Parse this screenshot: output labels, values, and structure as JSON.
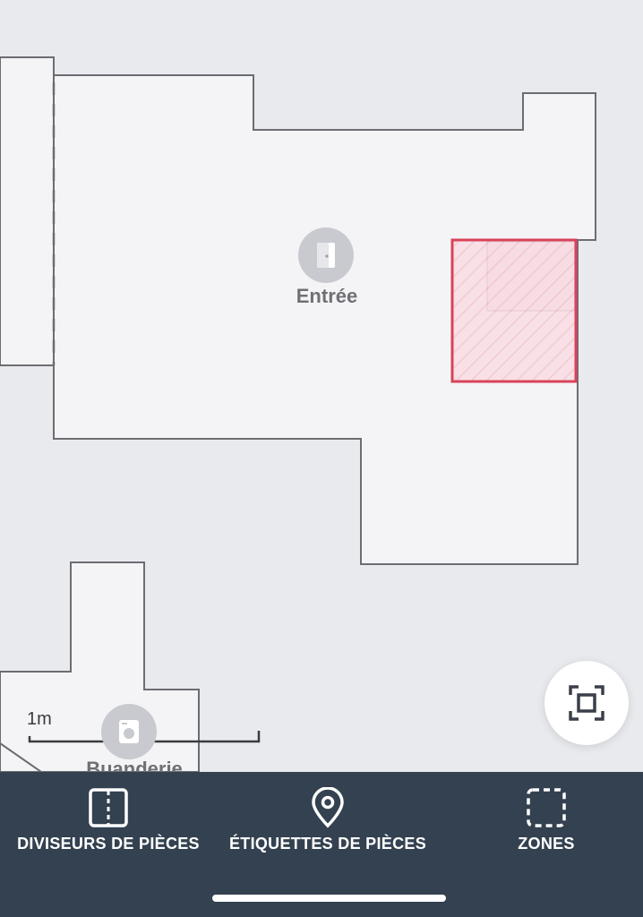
{
  "map": {
    "rooms": [
      {
        "name": "Entrée",
        "icon": "door-icon"
      },
      {
        "name": "Buanderie",
        "icon": "washing-machine-icon"
      }
    ],
    "scale_label": "1m",
    "zone_color": "#d9435a",
    "fit_button_icon": "fit-to-screen-icon"
  },
  "toolbar": {
    "tabs": [
      {
        "label": "DIVISEURS DE PIÈCES",
        "icon": "room-divider-icon"
      },
      {
        "label": "ÉTIQUETTES DE PIÈCES",
        "icon": "location-pin-icon"
      },
      {
        "label": "ZONES",
        "icon": "dashed-square-icon"
      }
    ]
  },
  "colors": {
    "map_background": "#e9eaee",
    "room_fill": "#f4f4f6",
    "wall": "#6c6d72",
    "toolbar_background": "#334150"
  }
}
